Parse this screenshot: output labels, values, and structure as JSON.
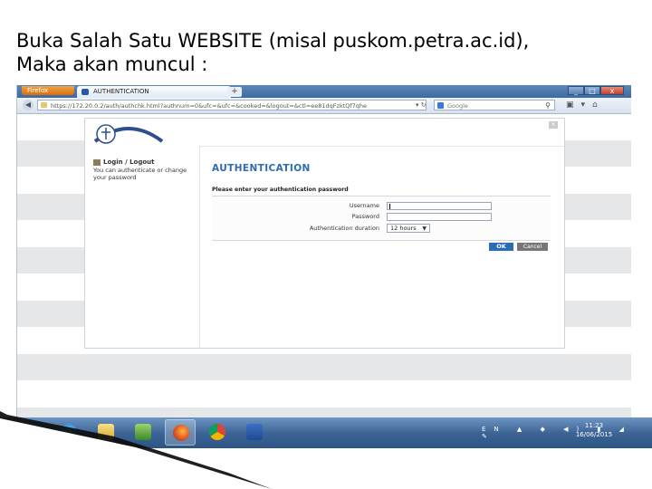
{
  "slide": {
    "title_line1": "Buka Salah Satu WEBSITE (misal puskom.petra.ac.id),",
    "title_line2": "Maka akan muncul :"
  },
  "browser": {
    "app_button": "Firefox",
    "tab_title": "AUTHENTICATION",
    "new_tab": "+",
    "url": "https://172.20.0.2/auth/authchk.html?authnum=0&ufc=&ufc=&cooked=&logout=&ctl=ee81dqFzktQf7qhe",
    "search_placeholder": "Google",
    "window_buttons": [
      "_",
      "□",
      "x"
    ]
  },
  "page": {
    "sidebar_heading": "Login / Logout",
    "sidebar_desc": "You can authenticate or change your password",
    "heading": "AUTHENTICATION",
    "instruction": "Please enter your authentication password",
    "username_label": "Username",
    "password_label": "Password",
    "duration_label": "Authentication duration",
    "duration_value": "12 hours",
    "ok_label": "OK",
    "cancel_label": "Cancel"
  },
  "taskbar": {
    "tray_lang": "EN",
    "clock_time": "11:23",
    "clock_date": "16/06/2015"
  },
  "colors": {
    "accent": "#2e6bb0",
    "taskbar": "#3d6697",
    "band": "#e6e7e9"
  }
}
